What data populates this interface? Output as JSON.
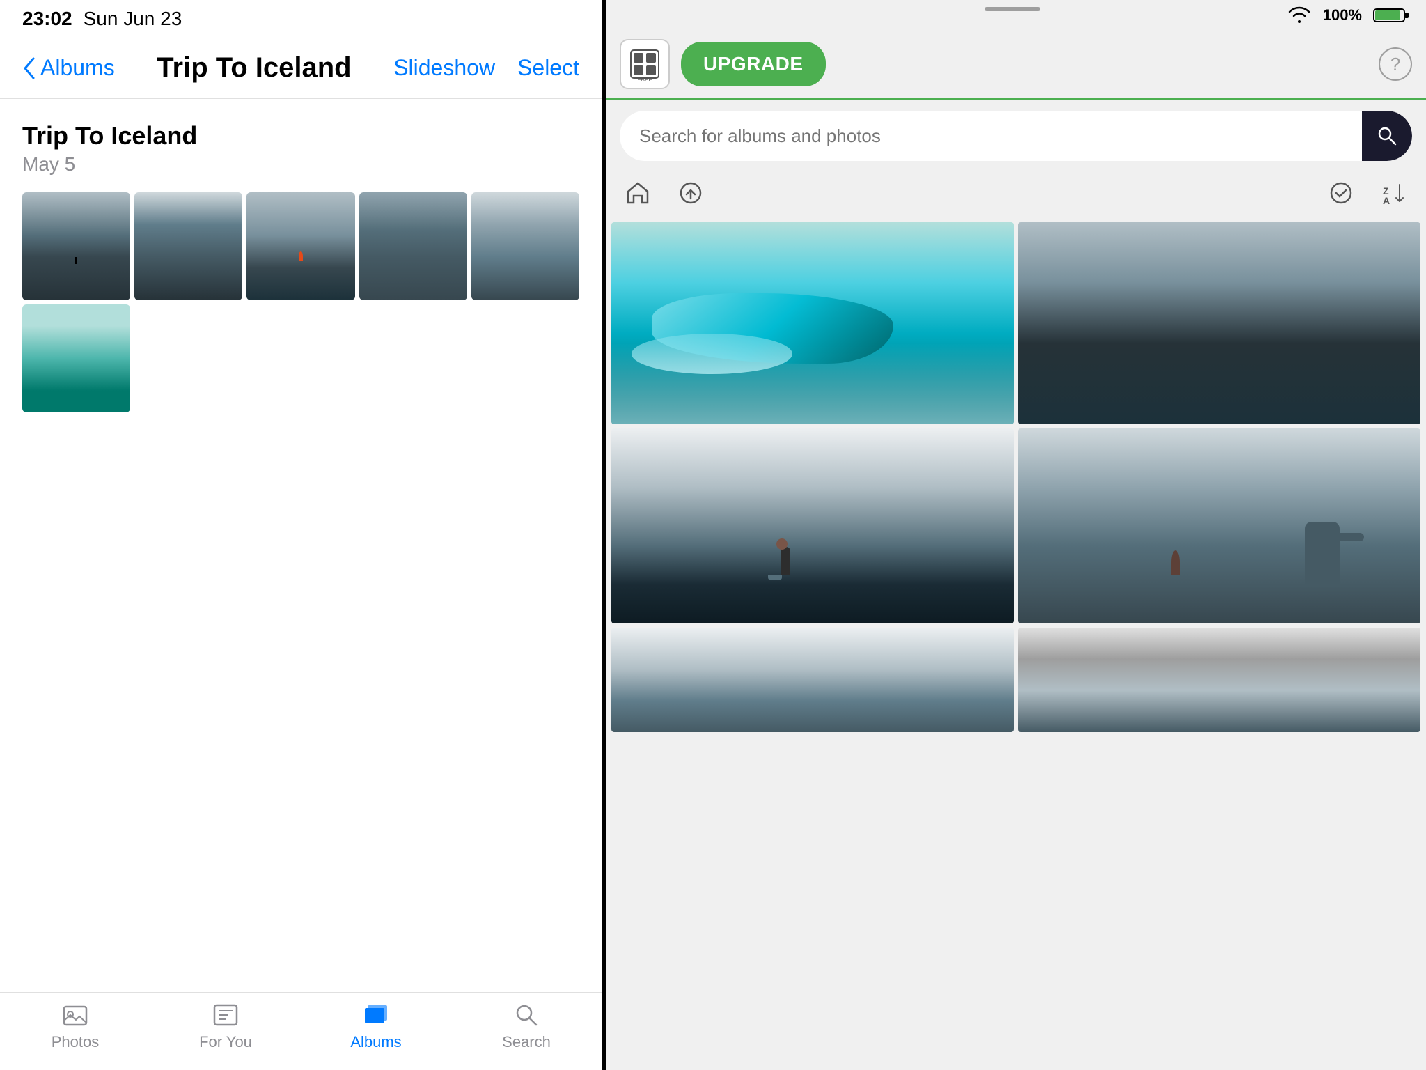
{
  "left": {
    "statusBar": {
      "time": "23:02",
      "date": "Sun Jun 23"
    },
    "navBar": {
      "backLabel": "Albums",
      "title": "Trip To Iceland",
      "slideshowLabel": "Slideshow",
      "selectLabel": "Select"
    },
    "album": {
      "title": "Trip To Iceland",
      "date": "May 5",
      "photoCount": 6
    },
    "tabBar": {
      "tabs": [
        {
          "id": "photos",
          "label": "Photos",
          "active": false
        },
        {
          "id": "for-you",
          "label": "For You",
          "active": false
        },
        {
          "id": "albums",
          "label": "Albums",
          "active": true
        },
        {
          "id": "search",
          "label": "Search",
          "active": false
        }
      ]
    }
  },
  "right": {
    "statusBar": {
      "battery": "100%",
      "wifi": true
    },
    "header": {
      "upgradeLabel": "UPGRADE",
      "helpLabel": "?"
    },
    "search": {
      "placeholder": "Search for albums and photos"
    },
    "toolbar": {
      "homeIcon": "home-icon",
      "uploadIcon": "upload-icon",
      "checkIcon": "check-circle-icon",
      "sortIcon": "sort-za-icon"
    },
    "photos": [
      {
        "id": "r1",
        "cssClass": "r-photo-1",
        "description": "Icebergs on black sand beach"
      },
      {
        "id": "r2",
        "cssClass": "r-photo-2",
        "description": "Black sand beach with waves"
      },
      {
        "id": "r3",
        "cssClass": "r-photo-3",
        "description": "Person on black beach"
      },
      {
        "id": "r4",
        "cssClass": "r-photo-4",
        "description": "Rock formation in mist"
      },
      {
        "id": "r5",
        "cssClass": "r-photo-5",
        "description": "Coastal misty scene"
      },
      {
        "id": "r6",
        "cssClass": "r-photo-6",
        "description": "Iceland landscape"
      }
    ]
  }
}
